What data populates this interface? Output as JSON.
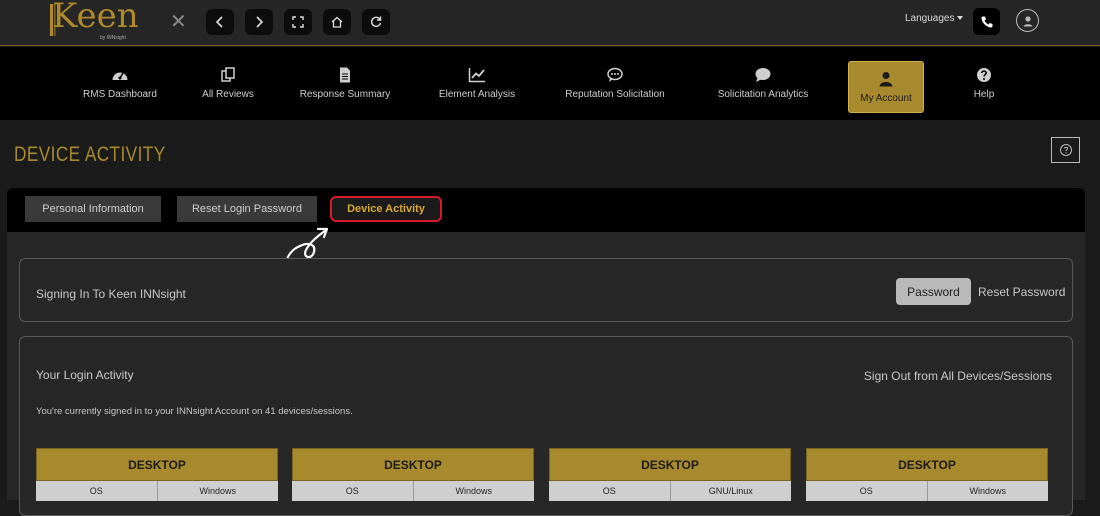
{
  "brand": {
    "name": "Keen",
    "sub": "by INNsight"
  },
  "header": {
    "languages_label": "Languages"
  },
  "nav": [
    {
      "label": "RMS Dashboard",
      "icon": "dashboard-icon"
    },
    {
      "label": "All Reviews",
      "icon": "copy-icon"
    },
    {
      "label": "Response Summary",
      "icon": "document-icon"
    },
    {
      "label": "Element Analysis",
      "icon": "line-chart-icon"
    },
    {
      "label": "Reputation Solicitation",
      "icon": "chat-dots-icon"
    },
    {
      "label": "Solicitation Analytics",
      "icon": "chat-bubble-icon"
    },
    {
      "label": "My Account",
      "icon": "user-icon",
      "active": true
    },
    {
      "label": "Help",
      "icon": "question-icon"
    }
  ],
  "page": {
    "title": "DEVICE ACTIVITY"
  },
  "tabs": [
    {
      "label": "Personal Information"
    },
    {
      "label": "Reset Login Password"
    },
    {
      "label": "Device Activity",
      "active": true
    }
  ],
  "signin": {
    "title": "Signing In To Keen INNsight",
    "password_button": "Password",
    "reset_link": "Reset Password"
  },
  "login_activity": {
    "title": "Your Login Activity",
    "signout_link": "Sign Out from All Devices/Sessions",
    "subtitle": "You're currently signed in to your INNsight Account on 41 devices/sessions.",
    "devices": [
      {
        "type": "DESKTOP",
        "os_label": "OS",
        "os_value": "Windows"
      },
      {
        "type": "DESKTOP",
        "os_label": "OS",
        "os_value": "Windows"
      },
      {
        "type": "DESKTOP",
        "os_label": "OS",
        "os_value": "GNU/Linux"
      },
      {
        "type": "DESKTOP",
        "os_label": "OS",
        "os_value": "Windows"
      }
    ]
  },
  "colors": {
    "accent": "#a88a2e",
    "highlight": "#d6192b",
    "active_tab_text": "#d9a92e"
  }
}
